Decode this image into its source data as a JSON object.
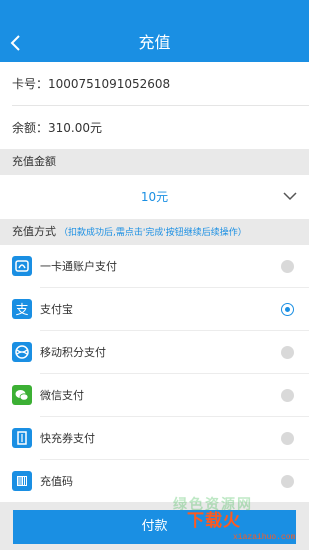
{
  "header": {
    "title": "充值"
  },
  "card": {
    "text": "卡号：1000751091052608"
  },
  "balance": {
    "text": "余额：310.00元"
  },
  "amount_section": {
    "title": "充值金额",
    "selected": "10元"
  },
  "method_section": {
    "title": "充值方式",
    "note": "（扣款成功后,需点击'完成'按钮继续后续操作）"
  },
  "methods": [
    {
      "label": "一卡通账户支付",
      "icon": "card-account-icon",
      "selected": false
    },
    {
      "label": "支付宝",
      "icon": "alipay-icon",
      "selected": true
    },
    {
      "label": "移动积分支付",
      "icon": "mobile-points-icon",
      "selected": false
    },
    {
      "label": "微信支付",
      "icon": "wechat-icon",
      "selected": false
    },
    {
      "label": "快充券支付",
      "icon": "voucher-icon",
      "selected": false
    },
    {
      "label": "充值码",
      "icon": "barcode-icon",
      "selected": false
    }
  ],
  "footer": {
    "pay_label": "付款"
  },
  "watermark": {
    "brand": "下载火",
    "url": "xiazaihuo.com",
    "bg_text": "绿色资源网"
  },
  "colors": {
    "accent": "#1a8fe3",
    "wechat": "#3cb034",
    "watermark": "#ff5a1f"
  }
}
